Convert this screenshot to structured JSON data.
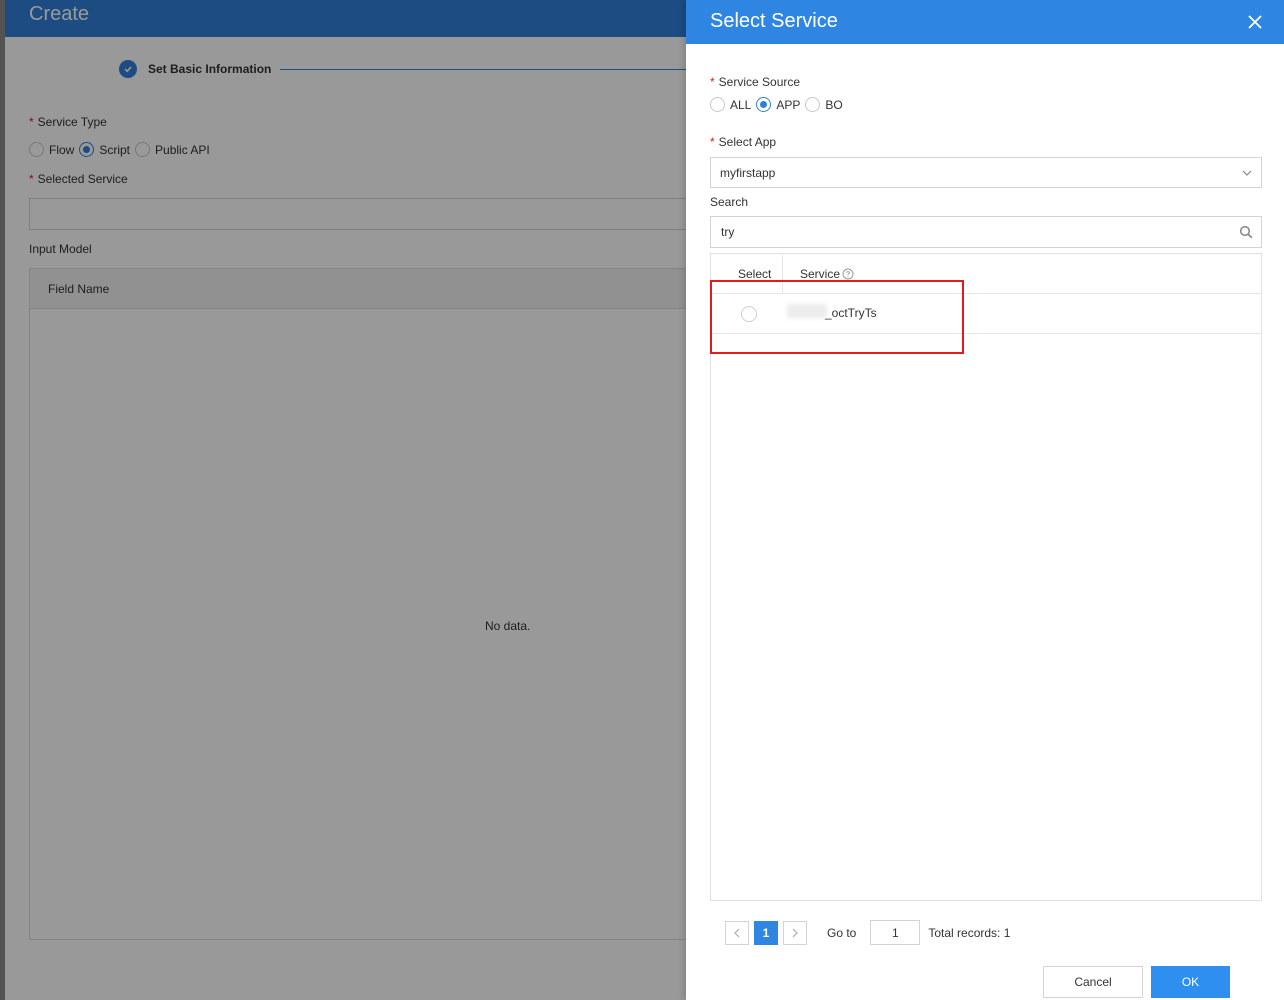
{
  "page": {
    "title": "Create",
    "step_label": "Set Basic Information",
    "service_type_label": "Service Type",
    "service_type_options": [
      "Flow",
      "Script",
      "Public API"
    ],
    "service_type_selected": "Script",
    "selected_service_label": "Selected Service",
    "input_model_label": "Input Model",
    "field_name_header": "Field Name",
    "no_data": "No data."
  },
  "drawer": {
    "title": "Select Service",
    "service_source_label": "Service Source",
    "service_source_options": [
      "ALL",
      "APP",
      "BO"
    ],
    "service_source_selected": "APP",
    "select_app_label": "Select App",
    "select_app_value": "myfirstapp",
    "search_label": "Search",
    "search_value": "try",
    "table": {
      "headers": {
        "select": "Select",
        "service": "Service"
      },
      "rows": [
        {
          "service": "_octTryTs"
        }
      ]
    },
    "pagination": {
      "current_page": "1",
      "goto_label": "Go to",
      "goto_value": "1",
      "total_records": "Total records: 1"
    },
    "buttons": {
      "cancel": "Cancel",
      "ok": "OK"
    }
  },
  "colors": {
    "primary": "#2f86e2",
    "required": "#e02020",
    "highlight": "#e01b1b"
  }
}
